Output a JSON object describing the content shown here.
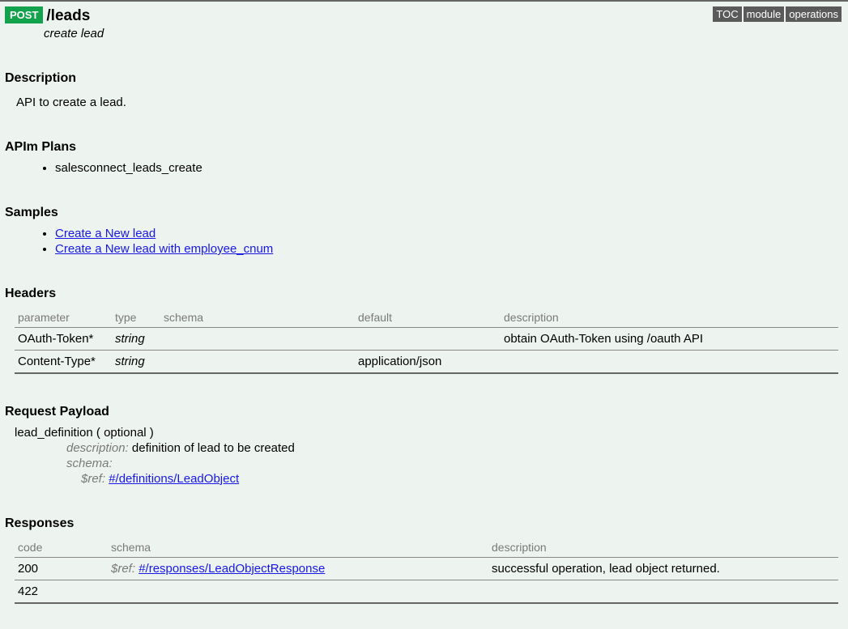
{
  "header": {
    "method": "POST",
    "path": "/leads",
    "summary": "create lead"
  },
  "nav": {
    "toc": "TOC",
    "module": "module",
    "operations": "operations"
  },
  "sections": {
    "description_heading": "Description",
    "description_text": "API to create a lead.",
    "plans_heading": "APIm Plans",
    "plans": [
      "salesconnect_leads_create"
    ],
    "samples_heading": "Samples",
    "samples": [
      "Create a New lead",
      "Create a New lead with employee_cnum"
    ],
    "headers_heading": "Headers",
    "headers_columns": {
      "parameter": "parameter",
      "type": "type",
      "schema": "schema",
      "default": "default",
      "description": "description"
    },
    "headers_rows": [
      {
        "parameter": "OAuth-Token*",
        "type": "string",
        "schema": "",
        "default": "",
        "description": "obtain OAuth-Token using /oauth API"
      },
      {
        "parameter": "Content-Type*",
        "type": "string",
        "schema": "",
        "default": "application/json",
        "description": ""
      }
    ],
    "payload_heading": "Request Payload",
    "payload": {
      "name": "lead_definition ( optional )",
      "desc_label": "description:",
      "desc_text": "definition of lead to be created",
      "schema_label": "schema:",
      "ref_label": "$ref:",
      "ref_link": "#/definitions/LeadObject"
    },
    "responses_heading": "Responses",
    "responses_columns": {
      "code": "code",
      "schema": "schema",
      "description": "description"
    },
    "responses_rows": [
      {
        "code": "200",
        "ref_label": "$ref:",
        "ref_link": "#/responses/LeadObjectResponse",
        "description": "successful operation, lead object returned."
      },
      {
        "code": "422",
        "ref_label": "",
        "ref_link": "",
        "description": ""
      }
    ]
  }
}
